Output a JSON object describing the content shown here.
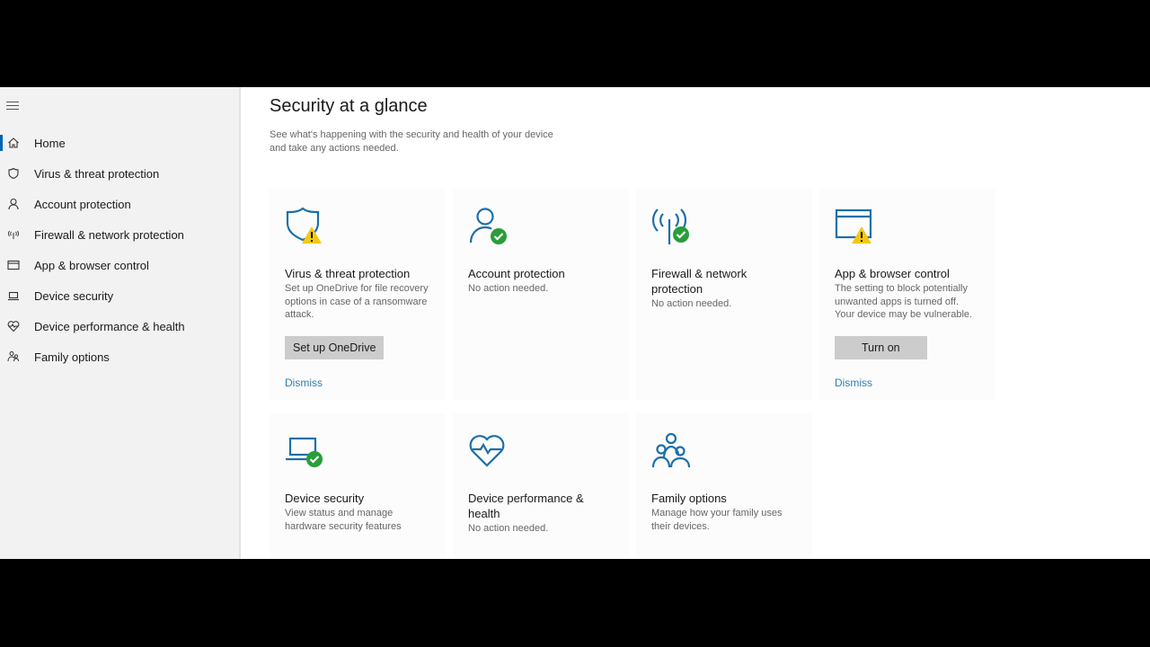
{
  "sidebar": {
    "items": [
      {
        "label": "Home",
        "icon": "home-icon"
      },
      {
        "label": "Virus & threat protection",
        "icon": "shield-icon"
      },
      {
        "label": "Account protection",
        "icon": "person-icon"
      },
      {
        "label": "Firewall & network protection",
        "icon": "antenna-icon"
      },
      {
        "label": "App & browser control",
        "icon": "browser-window-icon"
      },
      {
        "label": "Device security",
        "icon": "laptop-icon"
      },
      {
        "label": "Device performance & health",
        "icon": "heart-icon"
      },
      {
        "label": "Family options",
        "icon": "family-icon"
      }
    ]
  },
  "main": {
    "title": "Security at a glance",
    "subtitle": "See what's happening with the security and health of your device and take any actions needed.",
    "cards": [
      {
        "title": "Virus & threat protection",
        "desc": "Set up OneDrive for file recovery options in case of a ransomware attack.",
        "button": "Set up OneDrive",
        "dismiss": "Dismiss",
        "status": "warning"
      },
      {
        "title": "Account protection",
        "desc": "No action needed.",
        "status": "ok"
      },
      {
        "title": "Firewall & network protection",
        "desc": "No action needed.",
        "status": "ok"
      },
      {
        "title": "App & browser control",
        "desc": "The setting to block potentially unwanted apps is turned off. Your device may be vulnerable.",
        "button": "Turn on",
        "dismiss": "Dismiss",
        "status": "warning"
      },
      {
        "title": "Device security",
        "desc": "View status and manage hardware security features",
        "status": "ok"
      },
      {
        "title": "Device performance & health",
        "desc": "No action needed."
      },
      {
        "title": "Family options",
        "desc": "Manage how your family uses their devices."
      }
    ]
  },
  "colors": {
    "accent": "#0063b1",
    "icon": "#1e6fa8",
    "ok": "#2a9d3a",
    "warning": "#f2c811",
    "link": "#2d7fb6"
  }
}
